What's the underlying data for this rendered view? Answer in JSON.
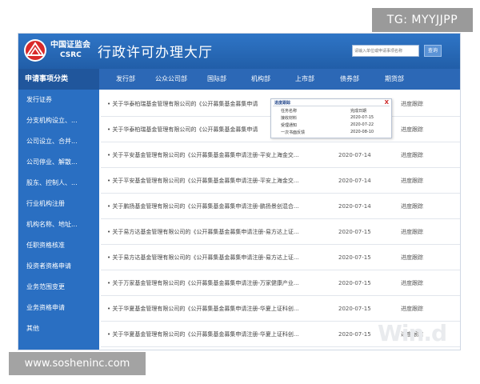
{
  "overlay_tag": "TG: MYYJJPP",
  "site_tag": "www.sosheninc.com",
  "watermark": "Win.d",
  "header": {
    "logo_cn": "中国证监会",
    "logo_en": "CSRC",
    "title": "行政许可办理大厅",
    "search_placeholder": "请输入单位或申请事项名称",
    "search_button": "查询"
  },
  "nav": {
    "left_label": "申请事项分类",
    "tabs": [
      "发行部",
      "公众公司部",
      "国际部",
      "机构部",
      "上市部",
      "债券部",
      "期货部"
    ]
  },
  "sidebar": {
    "items": [
      "发行证券",
      "分支机构设立、...",
      "公司设立、合并...",
      "公司停业、解散...",
      "股东、控制人、...",
      "行业机构注册",
      "机构名称、地址...",
      "任职资格核准",
      "投资者资格申请",
      "业务范围变更",
      "业务资格申请",
      "其他"
    ]
  },
  "rows": [
    {
      "title": "关于华泰柏瑞基金管理有限公司的《公开募集基金募集申请",
      "date": "",
      "link": "进度跟踪"
    },
    {
      "title": "关于华泰柏瑞基金管理有限公司的《公开募集基金募集申请",
      "date": "",
      "link": "进度跟踪"
    },
    {
      "title": "关于平安基金管理有限公司的《公开募集基金募集申请注册-平安上海金交...",
      "date": "2020-07-14",
      "link": "进度跟踪"
    },
    {
      "title": "关于平安基金管理有限公司的《公开募集基金募集申请注册-平安上海金交...",
      "date": "2020-07-14",
      "link": "进度跟踪"
    },
    {
      "title": "关于鹏扬基金管理有限公司的《公开募集基金募集申请注册-鹏扬景创混合...",
      "date": "2020-07-14",
      "link": "进度跟踪"
    },
    {
      "title": "关于易方达基金管理有限公司的《公开募集基金募集申请注册-易方达上证...",
      "date": "2020-07-15",
      "link": "进度跟踪"
    },
    {
      "title": "关于易方达基金管理有限公司的《公开募集基金募集申请注册-易方达上证...",
      "date": "2020-07-15",
      "link": "进度跟踪"
    },
    {
      "title": "关于万家基金管理有限公司的《公开募集基金募集申请注册-万家健康产业...",
      "date": "2020-07-15",
      "link": "进度跟踪"
    },
    {
      "title": "关于华夏基金管理有限公司的《公开募集基金募集申请注册-华夏上证科创...",
      "date": "2020-07-15",
      "link": "进度跟踪"
    },
    {
      "title": "关于华夏基金管理有限公司的《公开募集基金募集申请注册-华夏上证科创...",
      "date": "2020-07-15",
      "link": "进度跟踪"
    }
  ],
  "popup": {
    "title": "进度跟踪",
    "close": "X",
    "header": {
      "label": "任务名称",
      "value": "完成日期"
    },
    "items": [
      {
        "label": "接收材料",
        "value": "2020-07-15"
      },
      {
        "label": "受理通知",
        "value": "2020-07-22"
      },
      {
        "label": "一次书面反馈",
        "value": "2020-08-10"
      }
    ]
  },
  "colors": {
    "header": "#2f75c6",
    "nav": "#2c68b6",
    "sidebar": "#2a6fc2",
    "close": "#cc2222"
  }
}
